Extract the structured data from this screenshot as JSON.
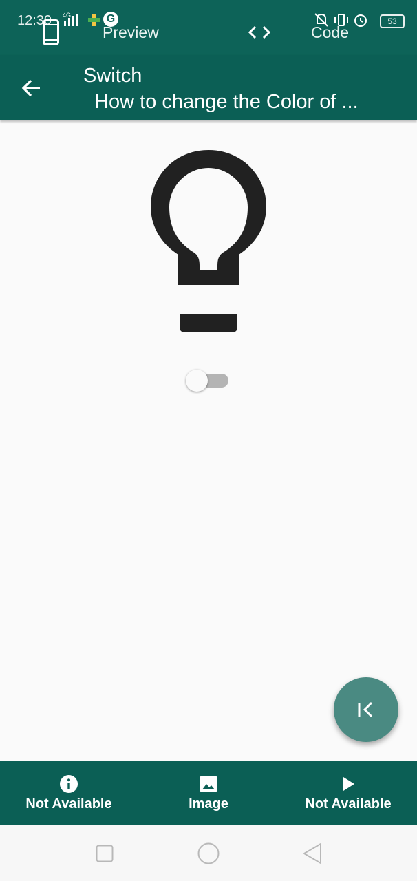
{
  "status_bar": {
    "time": "12:30",
    "network": "4G",
    "battery": "53"
  },
  "tabs": [
    {
      "label": "Preview",
      "icon": "phone-icon"
    },
    {
      "label": "Code",
      "icon": "code-icon"
    }
  ],
  "appbar": {
    "title": "Switch",
    "subtitle": "How to change the Color of ..."
  },
  "main": {
    "bulb_icon": "lightbulb-outline-icon",
    "switch_state": "off"
  },
  "fab": {
    "icon": "first-page-icon"
  },
  "bottom_nav": [
    {
      "label": "Not Available",
      "icon": "info-icon"
    },
    {
      "label": "Image",
      "icon": "image-icon"
    },
    {
      "label": "Not Available",
      "icon": "play-icon"
    }
  ],
  "colors": {
    "primary": "#0b5f55",
    "fab": "#4a8a82",
    "background": "#fafafa"
  }
}
